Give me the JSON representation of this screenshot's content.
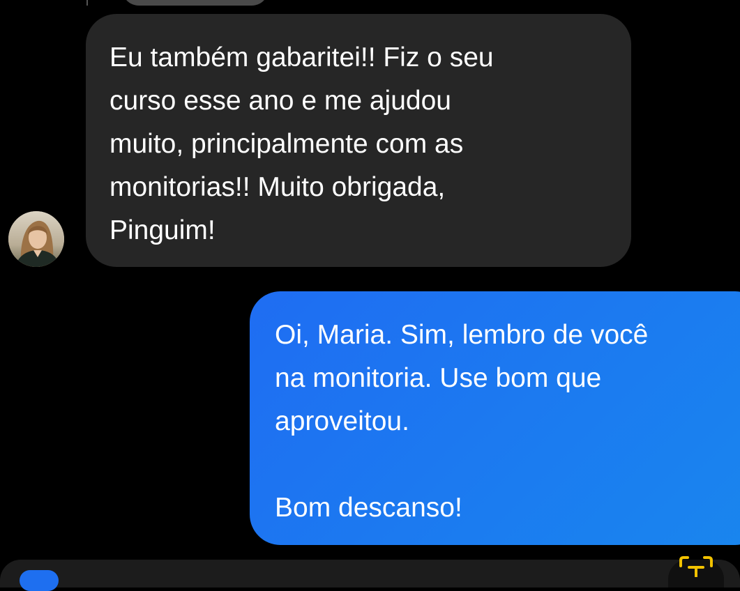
{
  "conversation": {
    "received_message": {
      "text": "Eu também gabaritei!! Fiz o seu\ncurso esse ano e me ajudou\nmuito, principalmente com as\nmonitorias!! Muito obrigada,\nPinguim!"
    },
    "sent_message": {
      "text": "Oi, Maria. Sim, lembro de você\nna monitoria. Use bom que\naproveitou.\n\nBom descanso!"
    }
  },
  "composer": {
    "text_format_icon": "text-format-icon"
  },
  "colors": {
    "background": "#000000",
    "received_bubble": "#262626",
    "sent_bubble": "#1f6df2",
    "icon_accent": "#f2c200"
  }
}
